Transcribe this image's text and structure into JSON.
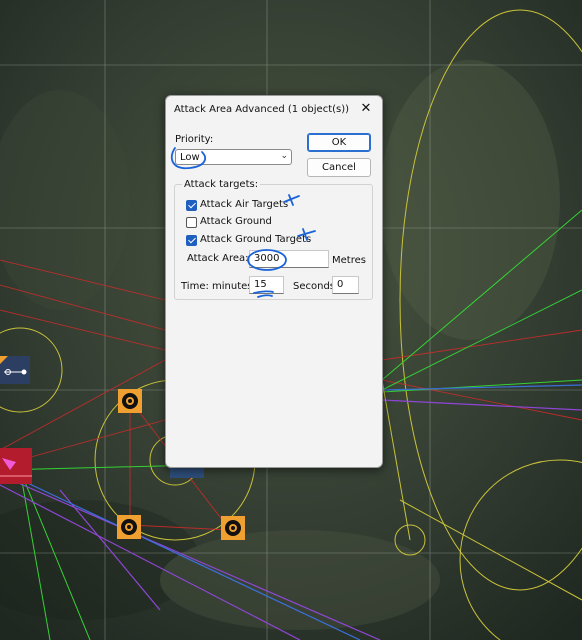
{
  "dialog": {
    "title": "Attack Area Advanced (1 object(s))",
    "close_icon": "close-icon",
    "priority_label": "Priority:",
    "priority_value": "Low",
    "ok_label": "OK",
    "cancel_label": "Cancel",
    "targets_group_label": "Attack targets:",
    "checkboxes": [
      {
        "label": "Attack Air Targets",
        "checked": true
      },
      {
        "label": "Attack Ground",
        "checked": false
      },
      {
        "label": "Attack Ground Targets",
        "checked": true
      }
    ],
    "area_label": "Attack Area:",
    "area_value": "3000",
    "area_unit": "Metres",
    "time_label": "Time: minutes",
    "minutes_value": "15",
    "seconds_label": "Seconds",
    "seconds_value": "0"
  },
  "colors": {
    "annotation": "#1a63d8",
    "map_green": "#35d235",
    "map_red": "#d42a2a",
    "map_yellow": "#c9c23a",
    "map_purple": "#8f46d6",
    "marker_orange": "#f0a030"
  }
}
